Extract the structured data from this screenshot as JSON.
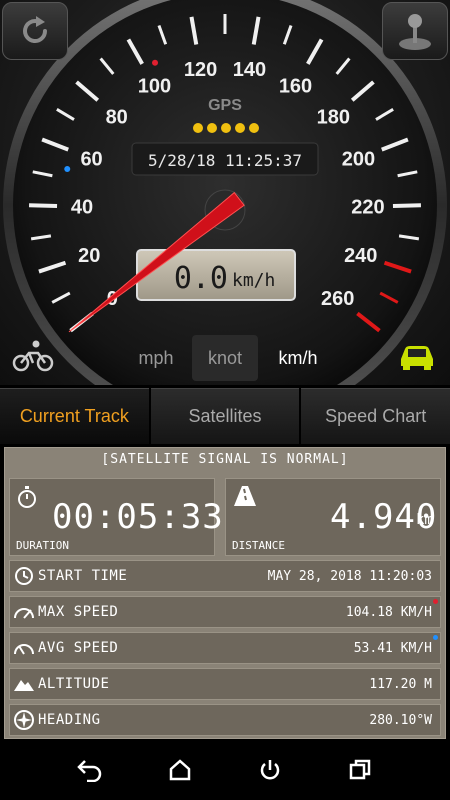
{
  "gauge": {
    "tick_labels": [
      "0",
      "20",
      "40",
      "60",
      "80",
      "100",
      "120",
      "140",
      "160",
      "180",
      "200",
      "220",
      "240",
      "260"
    ],
    "gps_label": "GPS",
    "gps_dots": 5,
    "datetime": "5/28/18 11:25:37",
    "speed_value": "0.0",
    "speed_unit": "km/h",
    "needle_speed": 0,
    "max_speed_marker": 104.18,
    "avg_speed_marker": 53.41,
    "colors": {
      "accent": "#f0a020",
      "needle": "#d0101a",
      "gps_dot": "#f0c010",
      "car": "#c8e000",
      "max_dot": "#e02030",
      "avg_dot": "#2090ff"
    }
  },
  "units": {
    "mph": "mph",
    "knot": "knot",
    "kmh": "km/h",
    "selected": "km/h"
  },
  "tabs": [
    {
      "label": "Current Track",
      "active": true
    },
    {
      "label": "Satellites",
      "active": false
    },
    {
      "label": "Speed Chart",
      "active": false
    }
  ],
  "track": {
    "signal_status": "[SATELLITE SIGNAL IS NORMAL]",
    "duration": {
      "value": "00:05:33",
      "label": "DURATION"
    },
    "distance": {
      "value": "4.940",
      "unit": "km",
      "label": "DISTANCE"
    },
    "rows": [
      {
        "icon": "clock-icon",
        "label": "START TIME",
        "value": "MAY 28, 2018 11:20:03"
      },
      {
        "icon": "max-speed-icon",
        "label": "MAX SPEED",
        "value": "104.18 KM/H"
      },
      {
        "icon": "avg-speed-icon",
        "label": "AVG SPEED",
        "value": "53.41 KM/H"
      },
      {
        "icon": "mountain-icon",
        "label": "ALTITUDE",
        "value": "117.20 M"
      },
      {
        "icon": "compass-icon",
        "label": "HEADING",
        "value": "280.10°W"
      }
    ]
  }
}
